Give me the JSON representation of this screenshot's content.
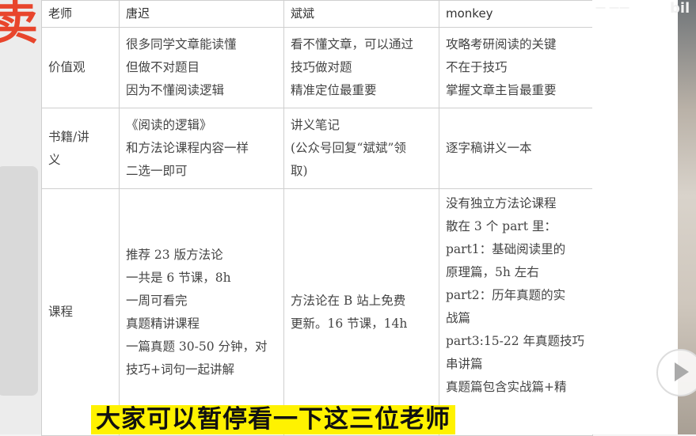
{
  "left_glyph": "卖",
  "watermark_text": "一 一一",
  "bili_logo": "bil",
  "table": {
    "headers": [
      "老师",
      "唐迟",
      "斌斌",
      "monkey"
    ],
    "rows": [
      {
        "label": [
          "价值观"
        ],
        "cells": [
          [
            "很多同学文章能读懂",
            "但做不对题目",
            "因为不懂阅读逻辑"
          ],
          [
            "看不懂文章，可以通过",
            "技巧做对题",
            "精准定位最重要"
          ],
          [
            "攻略考研阅读的关键",
            "不在于技巧",
            "掌握文章主旨最重要"
          ]
        ]
      },
      {
        "label": [
          "书籍/讲",
          "义"
        ],
        "cells": [
          [
            "《阅读的逻辑》",
            "和方法论课程内容一样",
            "二选一即可"
          ],
          [
            "讲义笔记",
            "(公众号回复“斌斌”领",
            "取)"
          ],
          [
            "逐字稿讲义一本"
          ]
        ]
      },
      {
        "label": [
          "课程"
        ],
        "cells": [
          [
            "推荐 23 版方法论",
            "一共是 6 节课，8h",
            "一周可看完",
            "真题精讲课程",
            "一篇真题 30-50 分钟，对",
            "技巧+词句一起讲解"
          ],
          [
            "方法论在 B 站上免费",
            "更新。16 节课，14h"
          ],
          [
            "没有独立方法论课程",
            "散在 3 个 part 里：",
            "part1：基础阅读里的",
            "原理篇，5h 左右",
            "part2：历年真题的实",
            "战篇",
            "part3:15-22 年真题技巧",
            "串讲篇",
            "真题篇包含实战篇+精"
          ]
        ]
      }
    ]
  },
  "subtitle": "大家可以暂停看一下这三位老师",
  "colors": {
    "subtitle_bg": "#fff200",
    "glyph": "#e8452c",
    "border": "#cfcfcf"
  }
}
